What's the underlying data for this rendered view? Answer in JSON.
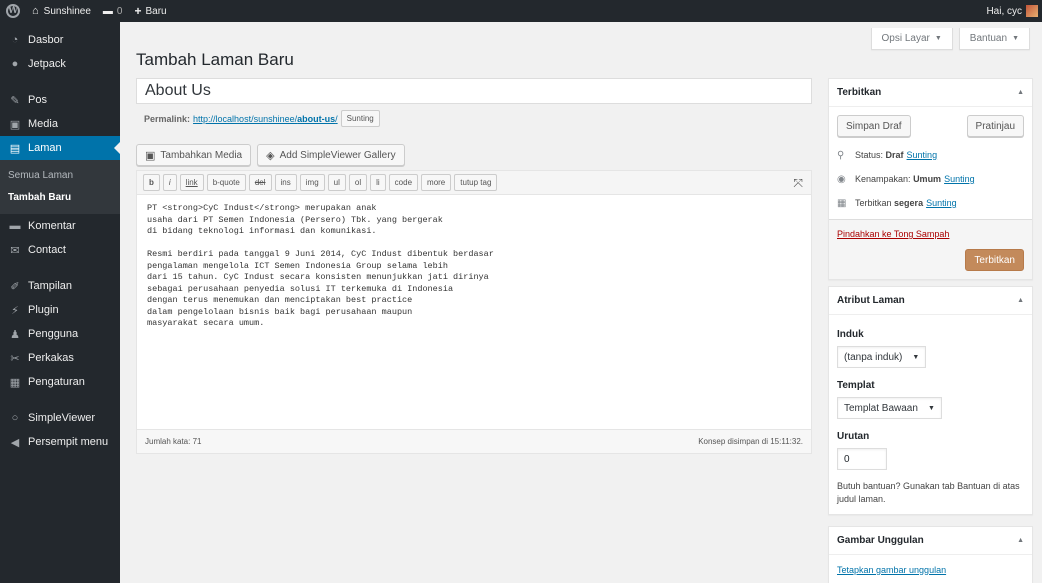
{
  "adminbar": {
    "site_name": "Sunshinee",
    "comments_count": "0",
    "new_label": "Baru",
    "greeting": "Hai, cyc"
  },
  "sidebar": {
    "items": [
      {
        "label": "Dasbor",
        "icon": "dashboard-icon"
      },
      {
        "label": "Jetpack",
        "icon": "jetpack-icon"
      },
      {
        "label": "Pos",
        "icon": "pin-icon"
      },
      {
        "label": "Media",
        "icon": "media-icon"
      },
      {
        "label": "Laman",
        "icon": "page-icon"
      },
      {
        "label": "Komentar",
        "icon": "comment-icon"
      },
      {
        "label": "Contact",
        "icon": "mail-icon"
      },
      {
        "label": "Tampilan",
        "icon": "appearance-icon"
      },
      {
        "label": "Plugin",
        "icon": "plugin-icon"
      },
      {
        "label": "Pengguna",
        "icon": "users-icon"
      },
      {
        "label": "Perkakas",
        "icon": "tools-icon"
      },
      {
        "label": "Pengaturan",
        "icon": "settings-icon"
      },
      {
        "label": "SimpleViewer",
        "icon": "circle-icon"
      },
      {
        "label": "Persempit menu",
        "icon": "collapse-icon"
      }
    ],
    "submenu": [
      "Semua Laman",
      "Tambah Baru"
    ]
  },
  "header": {
    "screen_options": "Opsi Layar",
    "help": "Bantuan",
    "title": "Tambah Laman Baru"
  },
  "editor": {
    "post_title": "About Us",
    "permalink_label": "Permalink:",
    "permalink_base": "http://localhost/sunshinee/",
    "permalink_slug": "about-us",
    "permalink_end": "/",
    "edit_slug": "Sunting",
    "add_media": "Tambahkan Media",
    "add_gallery": "Add SimpleViewer Gallery",
    "quicktags": [
      "b",
      "i",
      "link",
      "b-quote",
      "del",
      "ins",
      "img",
      "ul",
      "ol",
      "li",
      "code",
      "more",
      "tutup tag"
    ],
    "content": "PT <strong>CyC Indust</strong> merupakan anak\nusaha dari PT Semen Indonesia (Persero) Tbk. yang bergerak\ndi bidang teknologi informasi dan komunikasi.\n\nResmi berdiri pada tanggal 9 Juni 2014, CyC Indust dibentuk berdasar\npengalaman mengelola ICT Semen Indonesia Group selama lebih\ndari 15 tahun. CyC Indust secara konsisten menunjukkan jati dirinya\nsebagai perusahaan penyedia solusi IT terkemuka di Indonesia\ndengan terus menemukan dan menciptakan best practice\ndalam pengelolaan bisnis baik bagi perusahaan maupun\nmasyarakat secara umum.",
    "word_count": "Jumlah kata: 71",
    "draft_saved": "Konsep disimpan di 15:11:32."
  },
  "publish": {
    "title": "Terbitkan",
    "save_draft": "Simpan Draf",
    "preview": "Pratinjau",
    "status_label": "Status:",
    "status_value": "Draf",
    "visibility_label": "Kenampakan:",
    "visibility_value": "Umum",
    "publish_label": "Terbitkan",
    "publish_value": "segera",
    "edit": "Sunting",
    "trash": "Pindahkan ke Tong Sampah",
    "publish_button": "Terbitkan"
  },
  "attributes": {
    "title": "Atribut Laman",
    "parent_label": "Induk",
    "parent_value": "(tanpa induk)",
    "template_label": "Templat",
    "template_value": "Templat Bawaan",
    "order_label": "Urutan",
    "order_value": "0",
    "help": "Butuh bantuan? Gunakan tab Bantuan di atas judul laman."
  },
  "featured": {
    "title": "Gambar Unggulan",
    "set_link": "Tetapkan gambar unggulan"
  }
}
